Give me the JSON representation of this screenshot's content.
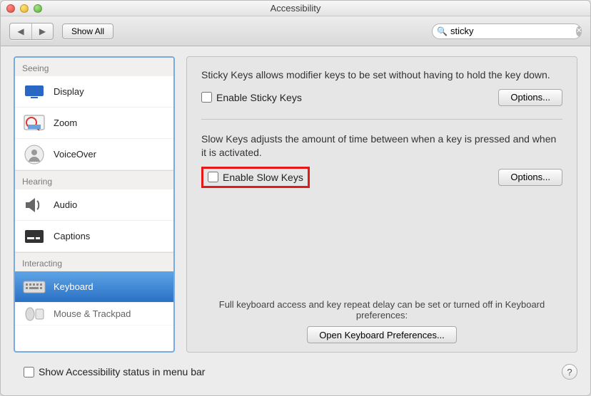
{
  "window": {
    "title": "Accessibility"
  },
  "toolbar": {
    "show_all_label": "Show All"
  },
  "search": {
    "value": "sticky"
  },
  "sidebar": {
    "sections": {
      "seeing": "Seeing",
      "hearing": "Hearing",
      "interacting": "Interacting"
    },
    "items": {
      "display": "Display",
      "zoom": "Zoom",
      "voiceover": "VoiceOver",
      "audio": "Audio",
      "captions": "Captions",
      "keyboard": "Keyboard",
      "mouse_trackpad": "Mouse & Trackpad"
    }
  },
  "main": {
    "sticky": {
      "desc": "Sticky Keys allows modifier keys to be set without having to hold the key down.",
      "enable_label": "Enable Sticky Keys",
      "options_label": "Options..."
    },
    "slow": {
      "desc": "Slow Keys adjusts the amount of time between when a key is pressed and when it is activated.",
      "enable_label": "Enable Slow Keys",
      "options_label": "Options..."
    },
    "footer": {
      "text": "Full keyboard access and key repeat delay can be set or turned off in Keyboard preferences:",
      "button": "Open Keyboard Preferences..."
    }
  },
  "bottom": {
    "status_label": "Show Accessibility status in menu bar"
  }
}
